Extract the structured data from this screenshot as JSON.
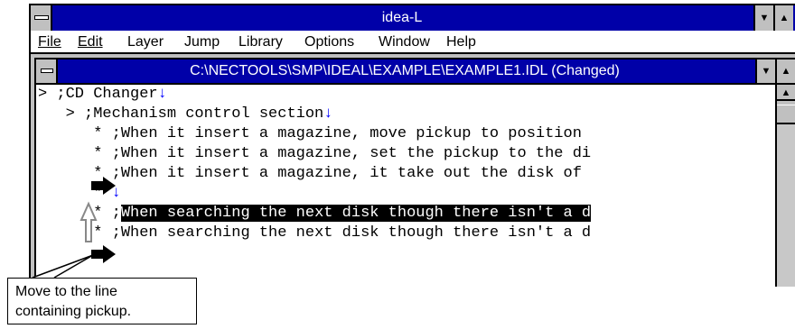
{
  "window": {
    "title": "idea-L"
  },
  "menu": {
    "items": [
      "File",
      "Edit",
      "Layer",
      "Jump",
      "Library",
      "Options",
      "Window",
      "Help"
    ]
  },
  "document": {
    "title": "C:\\NECTOOLS\\SMP\\IDEAL\\EXAMPLE\\EXAMPLE1.IDL (Changed)"
  },
  "editor": {
    "lines": [
      {
        "prefix": "> ;",
        "text": "CD Changer",
        "eol": "↓"
      },
      {
        "prefix": "   > ;",
        "text": "Mechanism control section",
        "eol": "↓"
      },
      {
        "prefix": "      * ;",
        "text": "When it insert a magazine, move pickup to position ",
        "eol": ""
      },
      {
        "prefix": "      * ;",
        "text": "When it insert a magazine, set the pickup to the di",
        "eol": ""
      },
      {
        "prefix": "      * ;",
        "text": "When it insert a magazine, it take out the disk of ",
        "eol": ""
      },
      {
        "prefix": "      * ",
        "text": "",
        "eol": "↓"
      },
      {
        "prefix": "      * ;",
        "text": "When searching the next disk though there isn't a d",
        "eol": ""
      },
      {
        "prefix": "      * ;",
        "text": "When searching the next disk though there isn't a d",
        "eol": ""
      }
    ]
  },
  "callout": {
    "line1": "Move to the line",
    "line2": "containing pickup."
  },
  "colors": {
    "titlebar": "#0000a8",
    "chrome": "#c0c0c0",
    "newline_mark": "#0000ff",
    "selection": "#000000"
  }
}
